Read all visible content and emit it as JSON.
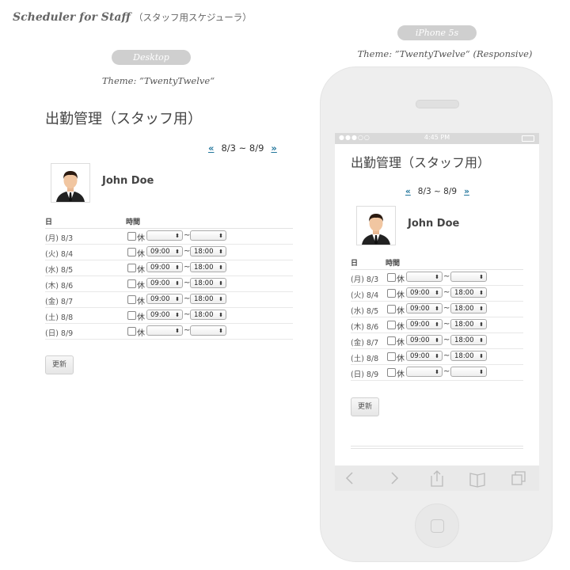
{
  "app_title": "Scheduler for Staff",
  "app_subtitle": "（スタッフ用スケジューラ）",
  "desktop": {
    "label": "Desktop",
    "theme": "Theme: ”TwentyTwelve“"
  },
  "mobile": {
    "label": "iPhone 5s",
    "theme": "Theme: ”TwentyTwelve“ (Responsive)",
    "status_time": "4:45 PM"
  },
  "schedule": {
    "title": "出勤管理（スタッフ用）",
    "prev": "«",
    "next": "»",
    "range": "8/3 ~ 8/9",
    "user_name": "John Doe",
    "col_day": "日",
    "col_time": "時間",
    "off_label": "休",
    "tilde": "~",
    "rows": [
      {
        "day": "(月) 8/3",
        "start": "",
        "end": ""
      },
      {
        "day": "(火) 8/4",
        "start": "09:00",
        "end": "18:00"
      },
      {
        "day": "(水) 8/5",
        "start": "09:00",
        "end": "18:00"
      },
      {
        "day": "(木) 8/6",
        "start": "09:00",
        "end": "18:00"
      },
      {
        "day": "(金) 8/7",
        "start": "09:00",
        "end": "18:00"
      },
      {
        "day": "(土) 8/8",
        "start": "09:00",
        "end": "18:00"
      },
      {
        "day": "(日) 8/9",
        "start": "",
        "end": ""
      }
    ],
    "update_button": "更新"
  }
}
